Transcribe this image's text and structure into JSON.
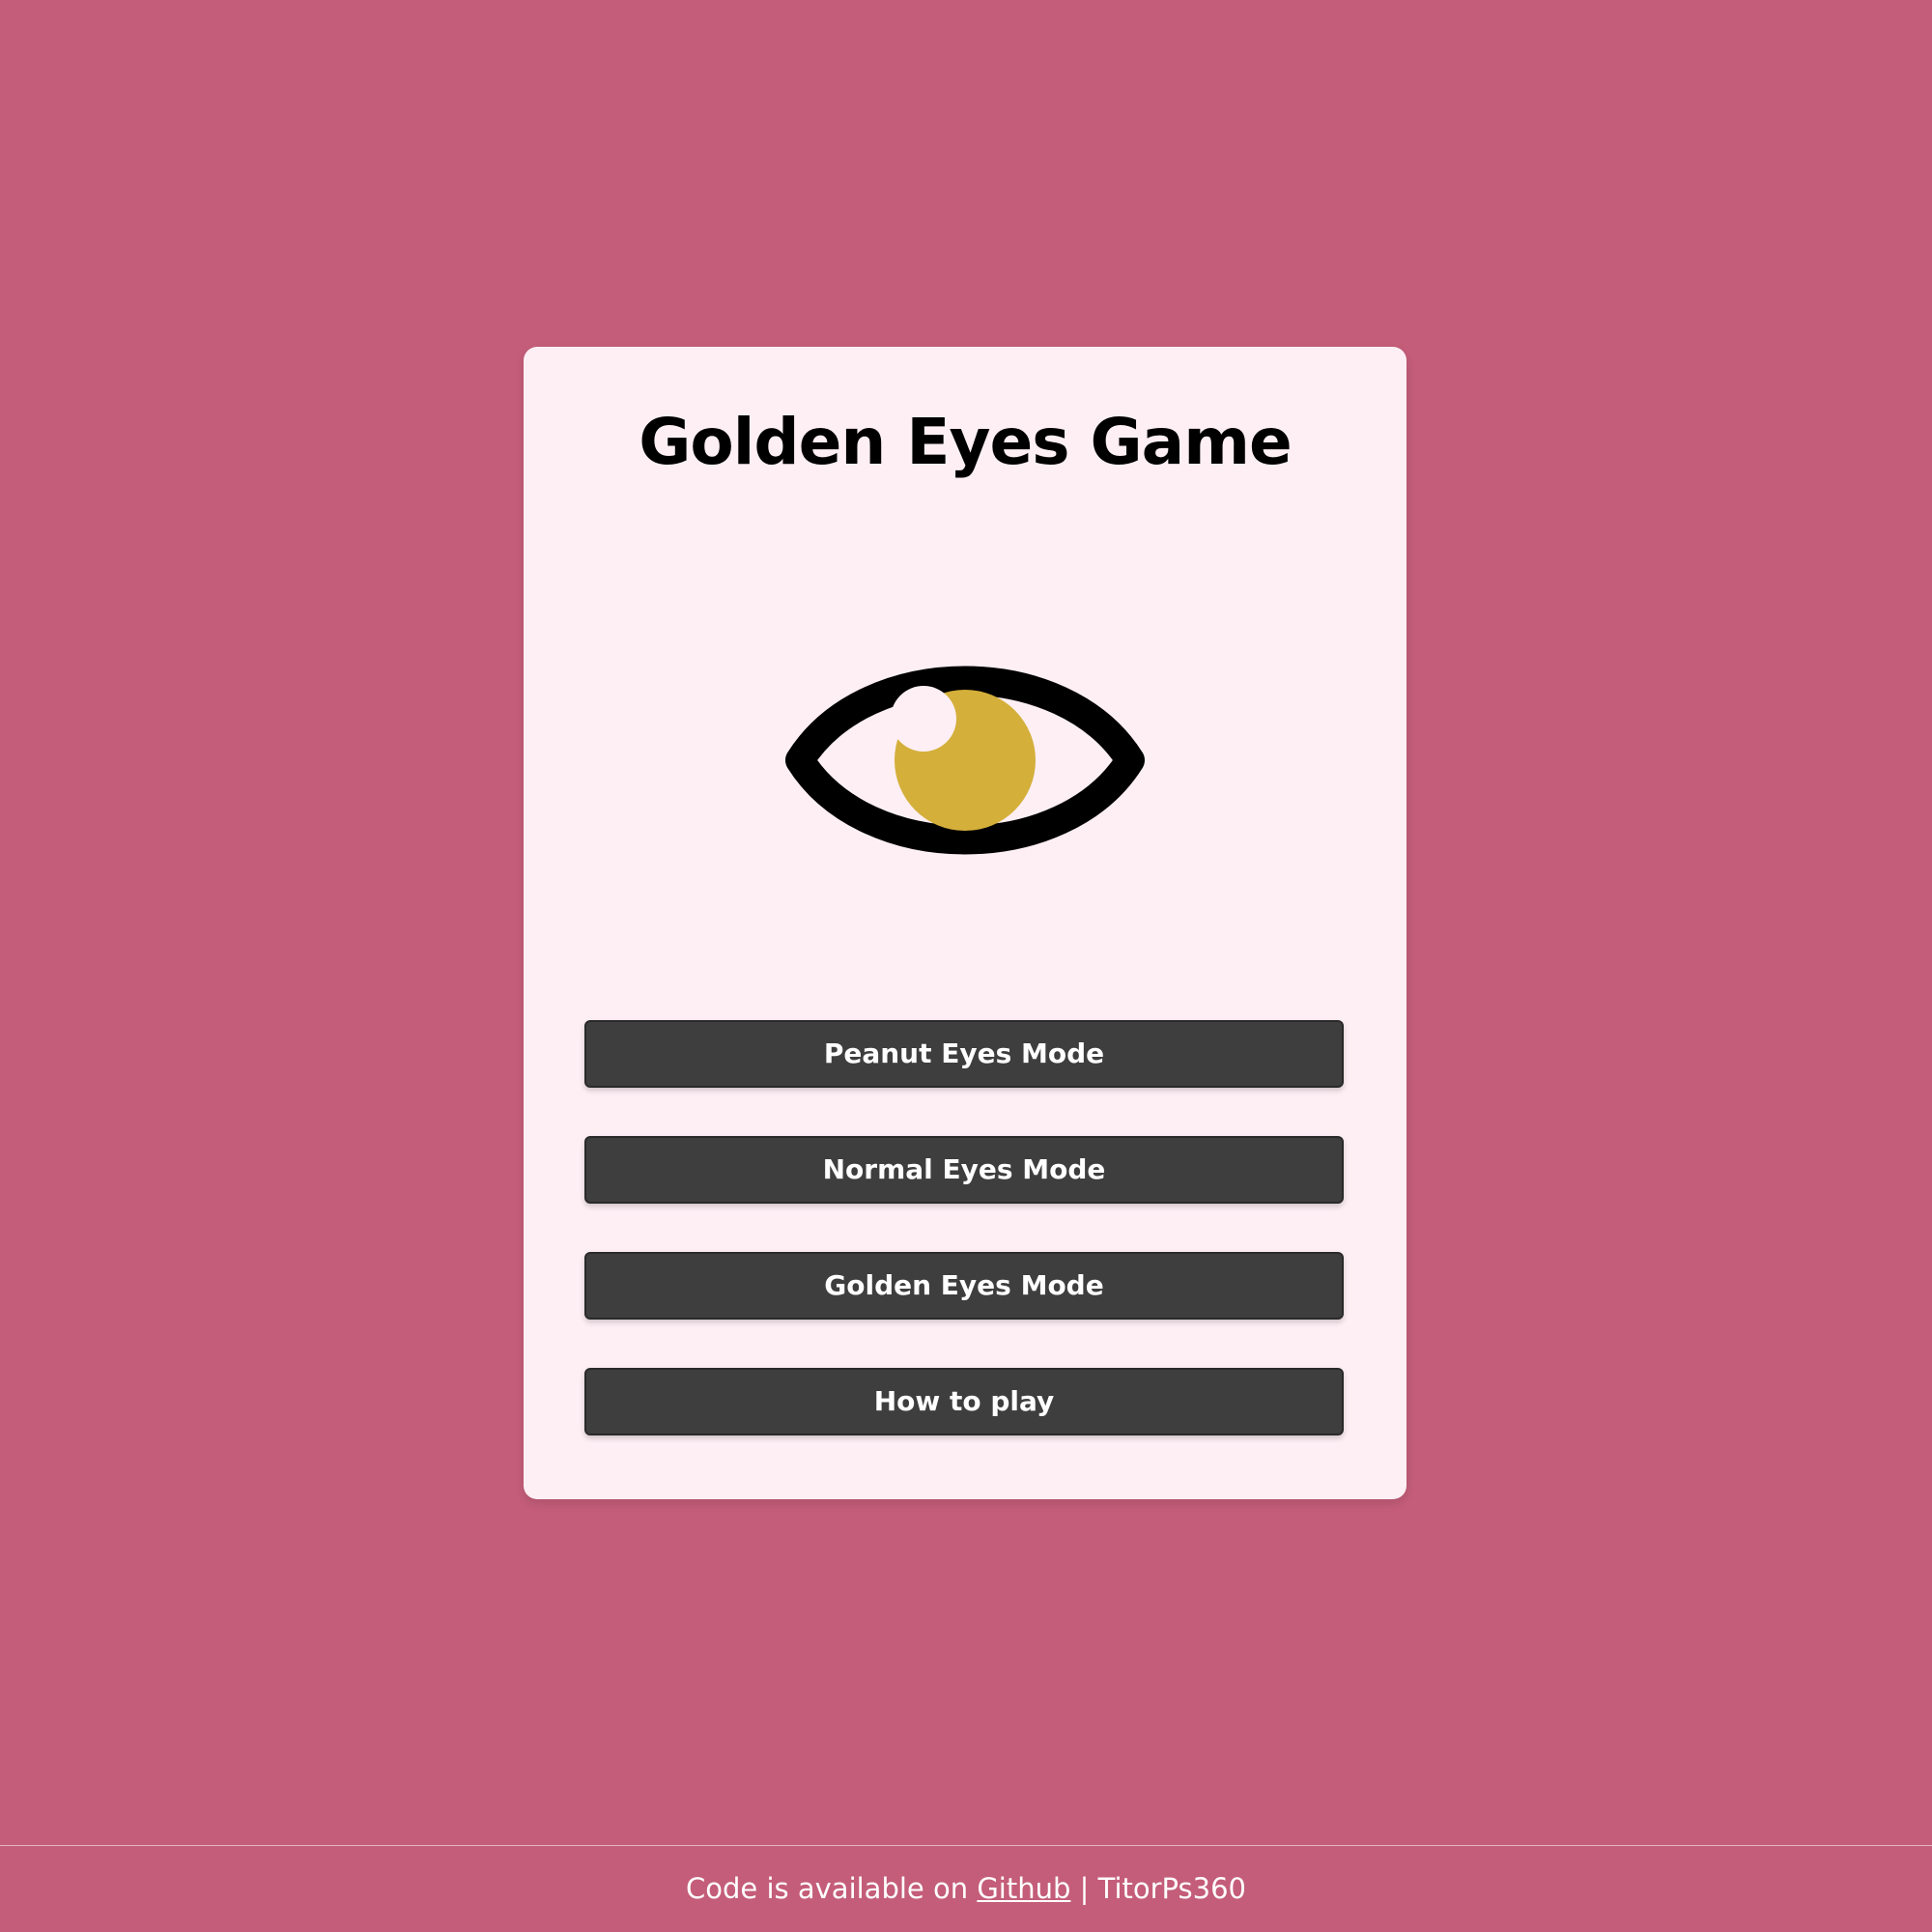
{
  "card": {
    "title": "Golden Eyes Game"
  },
  "logo": {
    "icon": "eye-icon",
    "iris_color": "#d4af3a",
    "outline_color": "#000000"
  },
  "menu": {
    "buttons": [
      {
        "label": "Peanut Eyes Mode"
      },
      {
        "label": "Normal Eyes Mode"
      },
      {
        "label": "Golden Eyes Mode"
      },
      {
        "label": "How to play"
      }
    ]
  },
  "footer": {
    "prefix": "Code is available on ",
    "link_label": "Github",
    "separator": " | ",
    "author": "TitorPs360"
  },
  "colors": {
    "background": "#c45d79",
    "card": "#fdeff4",
    "button": "#3e3e3e",
    "button_text": "#ffffff"
  }
}
